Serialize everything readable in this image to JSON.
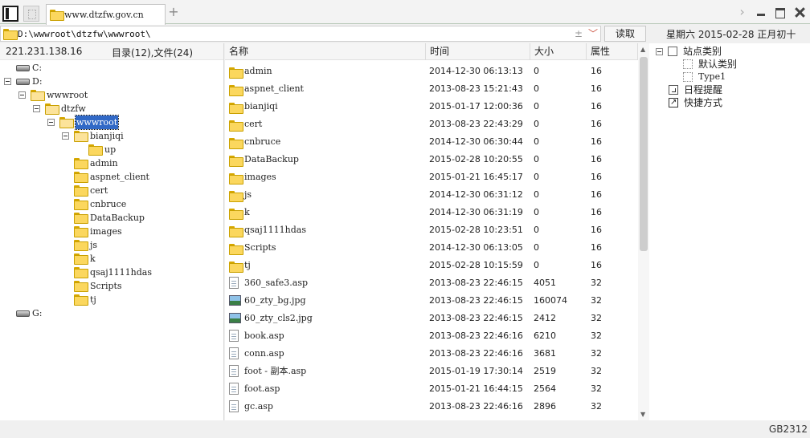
{
  "tab": {
    "title": "www.dtzfw.gov.cn",
    "add_icon": "+"
  },
  "address": {
    "path": "D:\\wwwroot\\dtzfw\\wwwroot\\",
    "read_label": "读取",
    "star_icon": "±",
    "dropdown_icon": "﹀"
  },
  "datetime": "星期六 2015-02-28 正月初十",
  "left": {
    "ip": "221.231.138.16",
    "counts": "目录(12),文件(24)",
    "tree": [
      {
        "label": "C:",
        "type": "drive",
        "depth": 0
      },
      {
        "label": "D:",
        "type": "drive",
        "depth": 0,
        "expanded": true
      },
      {
        "label": "wwwroot",
        "type": "folder",
        "depth": 1,
        "expanded": true
      },
      {
        "label": "dtzfw",
        "type": "folder",
        "depth": 2,
        "expanded": true
      },
      {
        "label": "wwwroot",
        "type": "folder",
        "depth": 3,
        "expanded": true,
        "selected": true
      },
      {
        "label": "bianjiqi",
        "type": "folder",
        "depth": 4,
        "expanded": true
      },
      {
        "label": "up",
        "type": "folder",
        "depth": 5
      },
      {
        "label": "admin",
        "type": "folder",
        "depth": 4
      },
      {
        "label": "aspnet_client",
        "type": "folder",
        "depth": 4
      },
      {
        "label": "cert",
        "type": "folder",
        "depth": 4
      },
      {
        "label": "cnbruce",
        "type": "folder",
        "depth": 4
      },
      {
        "label": "DataBackup",
        "type": "folder",
        "depth": 4
      },
      {
        "label": "images",
        "type": "folder",
        "depth": 4
      },
      {
        "label": "js",
        "type": "folder",
        "depth": 4
      },
      {
        "label": "k",
        "type": "folder",
        "depth": 4
      },
      {
        "label": "qsaj1111hdas",
        "type": "folder",
        "depth": 4
      },
      {
        "label": "Scripts",
        "type": "folder",
        "depth": 4
      },
      {
        "label": "tj",
        "type": "folder",
        "depth": 4
      },
      {
        "label": "G:",
        "type": "drive",
        "depth": 0
      }
    ]
  },
  "files": {
    "headers": {
      "name": "名称",
      "time": "时间",
      "size": "大小",
      "attr": "属性"
    },
    "rows": [
      {
        "icon": "folder",
        "name": "admin",
        "time": "2014-12-30 06:13:13",
        "size": "0",
        "attr": "16"
      },
      {
        "icon": "folder",
        "name": "aspnet_client",
        "time": "2013-08-23 15:21:43",
        "size": "0",
        "attr": "16"
      },
      {
        "icon": "folder",
        "name": "bianjiqi",
        "time": "2015-01-17 12:00:36",
        "size": "0",
        "attr": "16"
      },
      {
        "icon": "folder",
        "name": "cert",
        "time": "2013-08-23 22:43:29",
        "size": "0",
        "attr": "16"
      },
      {
        "icon": "folder",
        "name": "cnbruce",
        "time": "2014-12-30 06:30:44",
        "size": "0",
        "attr": "16"
      },
      {
        "icon": "folder",
        "name": "DataBackup",
        "time": "2015-02-28 10:20:55",
        "size": "0",
        "attr": "16"
      },
      {
        "icon": "folder",
        "name": "images",
        "time": "2015-01-21 16:45:17",
        "size": "0",
        "attr": "16"
      },
      {
        "icon": "folder",
        "name": "js",
        "time": "2014-12-30 06:31:12",
        "size": "0",
        "attr": "16"
      },
      {
        "icon": "folder",
        "name": "k",
        "time": "2014-12-30 06:31:19",
        "size": "0",
        "attr": "16"
      },
      {
        "icon": "folder",
        "name": "qsaj1111hdas",
        "time": "2015-02-28 10:23:51",
        "size": "0",
        "attr": "16"
      },
      {
        "icon": "folder",
        "name": "Scripts",
        "time": "2014-12-30 06:13:05",
        "size": "0",
        "attr": "16"
      },
      {
        "icon": "folder",
        "name": "tj",
        "time": "2015-02-28 10:15:59",
        "size": "0",
        "attr": "16"
      },
      {
        "icon": "file",
        "name": "360_safe3.asp",
        "time": "2013-08-23 22:46:15",
        "size": "4051",
        "attr": "32"
      },
      {
        "icon": "image",
        "name": "60_zty_bg.jpg",
        "time": "2013-08-23 22:46:15",
        "size": "160074",
        "attr": "32"
      },
      {
        "icon": "image",
        "name": "60_zty_cls2.jpg",
        "time": "2013-08-23 22:46:15",
        "size": "2412",
        "attr": "32"
      },
      {
        "icon": "file",
        "name": "book.asp",
        "time": "2013-08-23 22:46:16",
        "size": "6210",
        "attr": "32"
      },
      {
        "icon": "file",
        "name": "conn.asp",
        "time": "2013-08-23 22:46:16",
        "size": "3681",
        "attr": "32"
      },
      {
        "icon": "file",
        "name": "foot - 副本.asp",
        "time": "2015-01-19 17:30:14",
        "size": "2519",
        "attr": "32"
      },
      {
        "icon": "file",
        "name": "foot.asp",
        "time": "2015-01-21 16:44:15",
        "size": "2564",
        "attr": "32"
      },
      {
        "icon": "file",
        "name": "gc.asp",
        "time": "2013-08-23 22:46:16",
        "size": "2896",
        "attr": "32"
      }
    ]
  },
  "right": {
    "root": "站点类别",
    "children": [
      "默认类别",
      "Type1"
    ],
    "reminder": "日程提醒",
    "shortcut": "快捷方式"
  },
  "status": {
    "encoding": "GB2312"
  }
}
